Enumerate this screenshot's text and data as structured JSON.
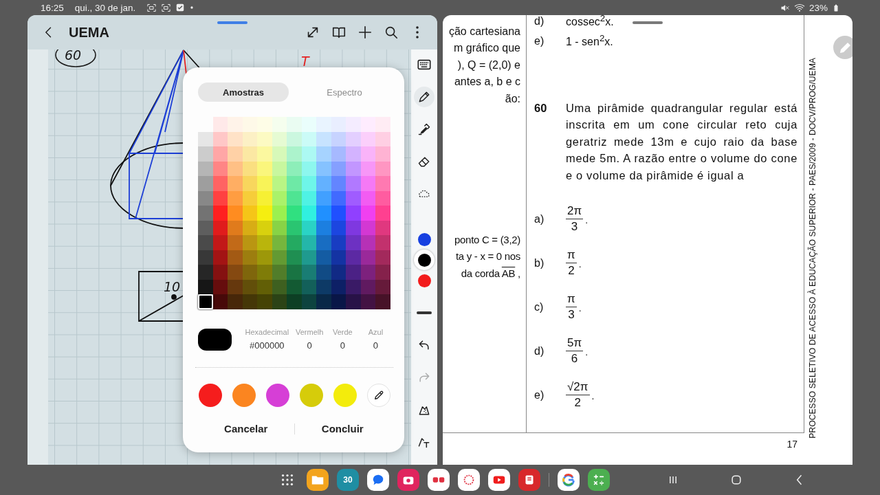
{
  "status_bar": {
    "time": "16:25",
    "date": "qui., 30 de jan.",
    "battery": "23%"
  },
  "note_app": {
    "title": "UEMA",
    "sketch_labels": [
      {
        "text": "60",
        "color": "#1a1a1a"
      },
      {
        "text": "T",
        "color": "#e52222"
      },
      {
        "text": "10",
        "color": "#1a1a1a"
      }
    ],
    "tools": [
      {
        "kind": "pen",
        "selected": true
      },
      {
        "kind": "highlighter",
        "selected": false
      },
      {
        "kind": "eraser",
        "selected": false
      },
      {
        "kind": "lasso",
        "selected": false
      }
    ],
    "pen_colors": [
      {
        "color": "#1740e0",
        "selected": false
      },
      {
        "color": "#000000",
        "selected": true
      },
      {
        "color": "#f21c1c",
        "selected": false
      }
    ],
    "history": [
      {
        "kind": "undo",
        "disabled": false
      },
      {
        "kind": "redo",
        "disabled": true
      }
    ],
    "shape_tools": [
      {
        "kind": "shape"
      },
      {
        "kind": "text-shape"
      }
    ]
  },
  "color_picker": {
    "tabs": [
      {
        "label": "Amostras",
        "selected": true
      },
      {
        "label": "Espectro",
        "selected": false
      }
    ],
    "grey_swatches": [
      {
        "color": "#E6E6E6",
        "selected": false
      },
      {
        "color": "#CCCCCC",
        "selected": false
      },
      {
        "color": "#B5B5B5",
        "selected": false
      },
      {
        "color": "#9E9E9E",
        "selected": false
      },
      {
        "color": "#888888",
        "selected": false
      },
      {
        "color": "#737373",
        "selected": false
      },
      {
        "color": "#5E5E5E",
        "selected": false
      },
      {
        "color": "#4A4A4A",
        "selected": false
      },
      {
        "color": "#383838",
        "selected": false
      },
      {
        "color": "#262626",
        "selected": false
      },
      {
        "color": "#161616",
        "selected": false
      },
      {
        "color": "#000000",
        "selected": true
      }
    ],
    "swatch_rows": [
      [
        {
          "color": "#FFE9E9",
          "selected": false
        },
        {
          "color": "#FFF3E9",
          "selected": false
        },
        {
          "color": "#FEF9E8",
          "selected": false
        },
        {
          "color": "#FEFDE7",
          "selected": false
        },
        {
          "color": "#F5FEEE",
          "selected": false
        },
        {
          "color": "#EAFCF2",
          "selected": false
        },
        {
          "color": "#EAFEFC",
          "selected": false
        },
        {
          "color": "#E9F4FF",
          "selected": false
        },
        {
          "color": "#E9EEFF",
          "selected": false
        },
        {
          "color": "#F4ECFF",
          "selected": false
        },
        {
          "color": "#FEECFE",
          "selected": false
        },
        {
          "color": "#FFECF4",
          "selected": false
        }
      ],
      [
        {
          "color": "#FFC7C7",
          "selected": false
        },
        {
          "color": "#FFE2C7",
          "selected": false
        },
        {
          "color": "#FCF0C5",
          "selected": false
        },
        {
          "color": "#FCFAC3",
          "selected": false
        },
        {
          "color": "#E6FBD3",
          "selected": false
        },
        {
          "color": "#CBF7DF",
          "selected": false
        },
        {
          "color": "#CBFBF7",
          "selected": false
        },
        {
          "color": "#C7E3FF",
          "selected": false
        },
        {
          "color": "#C7D3FF",
          "selected": false
        },
        {
          "color": "#E3CFFF",
          "selected": false
        },
        {
          "color": "#FBCFFB",
          "selected": false
        },
        {
          "color": "#FFCFE3",
          "selected": false
        }
      ],
      [
        {
          "color": "#FFA6A6",
          "selected": false
        },
        {
          "color": "#FFD1A6",
          "selected": false
        },
        {
          "color": "#FBE8A3",
          "selected": false
        },
        {
          "color": "#FBF89F",
          "selected": false
        },
        {
          "color": "#D7F9B9",
          "selected": false
        },
        {
          "color": "#ACF3CC",
          "selected": false
        },
        {
          "color": "#ACF9F3",
          "selected": false
        },
        {
          "color": "#A6D3FF",
          "selected": false
        },
        {
          "color": "#A6B9FF",
          "selected": false
        },
        {
          "color": "#D3B3FF",
          "selected": false
        },
        {
          "color": "#F9B3F9",
          "selected": false
        },
        {
          "color": "#FFB3D3",
          "selected": false
        }
      ],
      [
        {
          "color": "#FF8585",
          "selected": false
        },
        {
          "color": "#FFC085",
          "selected": false
        },
        {
          "color": "#FADF80",
          "selected": false
        },
        {
          "color": "#FAF67C",
          "selected": false
        },
        {
          "color": "#C8F79F",
          "selected": false
        },
        {
          "color": "#8DEEB9",
          "selected": false
        },
        {
          "color": "#8DF7EE",
          "selected": false
        },
        {
          "color": "#85C2FF",
          "selected": false
        },
        {
          "color": "#859FFF",
          "selected": false
        },
        {
          "color": "#C296FF",
          "selected": false
        },
        {
          "color": "#F796F7",
          "selected": false
        },
        {
          "color": "#FF96C2",
          "selected": false
        }
      ],
      [
        {
          "color": "#FF6363",
          "selected": false
        },
        {
          "color": "#FFAE63",
          "selected": false
        },
        {
          "color": "#F8D65D",
          "selected": false
        },
        {
          "color": "#F8F358",
          "selected": false
        },
        {
          "color": "#B9F585",
          "selected": false
        },
        {
          "color": "#6EE9A6",
          "selected": false
        },
        {
          "color": "#6EF5E9",
          "selected": false
        },
        {
          "color": "#63B1FF",
          "selected": false
        },
        {
          "color": "#6385FF",
          "selected": false
        },
        {
          "color": "#B179FF",
          "selected": false
        },
        {
          "color": "#F579F5",
          "selected": false
        },
        {
          "color": "#FF79B1",
          "selected": false
        }
      ],
      [
        {
          "color": "#FF4141",
          "selected": false
        },
        {
          "color": "#FF9D41",
          "selected": false
        },
        {
          "color": "#F6CD3A",
          "selected": false
        },
        {
          "color": "#F6F034",
          "selected": false
        },
        {
          "color": "#AAF26A",
          "selected": false
        },
        {
          "color": "#4FE493",
          "selected": false
        },
        {
          "color": "#4FF2E4",
          "selected": false
        },
        {
          "color": "#41A0FF",
          "selected": false
        },
        {
          "color": "#416AFF",
          "selected": false
        },
        {
          "color": "#A05CFF",
          "selected": false
        },
        {
          "color": "#F25CF2",
          "selected": false
        },
        {
          "color": "#FF5CA0",
          "selected": false
        }
      ],
      [
        {
          "color": "#FF2020",
          "selected": false
        },
        {
          "color": "#FF8C20",
          "selected": false
        },
        {
          "color": "#F5C518",
          "selected": false
        },
        {
          "color": "#F5EE10",
          "selected": false
        },
        {
          "color": "#9BF050",
          "selected": false
        },
        {
          "color": "#30E080",
          "selected": false
        },
        {
          "color": "#30F0E0",
          "selected": false
        },
        {
          "color": "#2090FF",
          "selected": false
        },
        {
          "color": "#2050FF",
          "selected": false
        },
        {
          "color": "#9040FF",
          "selected": false
        },
        {
          "color": "#F040F0",
          "selected": false
        },
        {
          "color": "#FF4090",
          "selected": false
        }
      ],
      [
        {
          "color": "#E01C1C",
          "selected": false
        },
        {
          "color": "#E07B1C",
          "selected": false
        },
        {
          "color": "#D8AD15",
          "selected": false
        },
        {
          "color": "#D8D10E",
          "selected": false
        },
        {
          "color": "#88D346",
          "selected": false
        },
        {
          "color": "#2AC571",
          "selected": false
        },
        {
          "color": "#2AD3C5",
          "selected": false
        },
        {
          "color": "#1C7FE0",
          "selected": false
        },
        {
          "color": "#1C46E0",
          "selected": false
        },
        {
          "color": "#7F38E0",
          "selected": false
        },
        {
          "color": "#D338D3",
          "selected": false
        },
        {
          "color": "#E0387F",
          "selected": false
        }
      ],
      [
        {
          "color": "#C21818",
          "selected": false
        },
        {
          "color": "#C26A18",
          "selected": false
        },
        {
          "color": "#BA9612",
          "selected": false
        },
        {
          "color": "#BAB50C",
          "selected": false
        },
        {
          "color": "#76B63D",
          "selected": false
        },
        {
          "color": "#24AA61",
          "selected": false
        },
        {
          "color": "#24B6AA",
          "selected": false
        },
        {
          "color": "#186DC2",
          "selected": false
        },
        {
          "color": "#183DC2",
          "selected": false
        },
        {
          "color": "#6D31C2",
          "selected": false
        },
        {
          "color": "#B631B6",
          "selected": false
        },
        {
          "color": "#C2316D",
          "selected": false
        }
      ],
      [
        {
          "color": "#A31414",
          "selected": false
        },
        {
          "color": "#A35A14",
          "selected": false
        },
        {
          "color": "#9D7E0F",
          "selected": false
        },
        {
          "color": "#9D980A",
          "selected": false
        },
        {
          "color": "#639A33",
          "selected": false
        },
        {
          "color": "#1F8F52",
          "selected": false
        },
        {
          "color": "#1F9A8F",
          "selected": false
        },
        {
          "color": "#145CA3",
          "selected": false
        },
        {
          "color": "#1433A3",
          "selected": false
        },
        {
          "color": "#5C29A3",
          "selected": false
        },
        {
          "color": "#9A299A",
          "selected": false
        },
        {
          "color": "#A3295C",
          "selected": false
        }
      ],
      [
        {
          "color": "#851111",
          "selected": false
        },
        {
          "color": "#854911",
          "selected": false
        },
        {
          "color": "#7F660C",
          "selected": false
        },
        {
          "color": "#7F7C08",
          "selected": false
        },
        {
          "color": "#517D2A",
          "selected": false
        },
        {
          "color": "#197443",
          "selected": false
        },
        {
          "color": "#197D74",
          "selected": false
        },
        {
          "color": "#114B85",
          "selected": false
        },
        {
          "color": "#112A85",
          "selected": false
        },
        {
          "color": "#4B2185",
          "selected": false
        },
        {
          "color": "#7D217D",
          "selected": false
        },
        {
          "color": "#85214B",
          "selected": false
        }
      ],
      [
        {
          "color": "#660D0D",
          "selected": false
        },
        {
          "color": "#66380D",
          "selected": false
        },
        {
          "color": "#624F0A",
          "selected": false
        },
        {
          "color": "#625F06",
          "selected": false
        },
        {
          "color": "#3E6020",
          "selected": false
        },
        {
          "color": "#135A33",
          "selected": false
        },
        {
          "color": "#13605A",
          "selected": false
        },
        {
          "color": "#0D3A66",
          "selected": false
        },
        {
          "color": "#0D2066",
          "selected": false
        },
        {
          "color": "#3A1A66",
          "selected": false
        },
        {
          "color": "#601A60",
          "selected": false
        },
        {
          "color": "#661A3A",
          "selected": false
        }
      ],
      [
        {
          "color": "#470909",
          "selected": false
        },
        {
          "color": "#472709",
          "selected": false
        },
        {
          "color": "#453707",
          "selected": false
        },
        {
          "color": "#454304",
          "selected": false
        },
        {
          "color": "#2B4316",
          "selected": false
        },
        {
          "color": "#0D3F24",
          "selected": false
        },
        {
          "color": "#0D433F",
          "selected": false
        },
        {
          "color": "#092847",
          "selected": false
        },
        {
          "color": "#091647",
          "selected": false
        },
        {
          "color": "#281247",
          "selected": false
        },
        {
          "color": "#431243",
          "selected": false
        },
        {
          "color": "#471228",
          "selected": false
        }
      ]
    ],
    "fields": [
      {
        "label": "Hexadecimal",
        "value": "#000000"
      },
      {
        "label": "Vermelh",
        "value": "0"
      },
      {
        "label": "Verde",
        "value": "0"
      },
      {
        "label": "Azul",
        "value": "0"
      }
    ],
    "recent_colors": [
      {
        "color": "#f51d1d"
      },
      {
        "color": "#fb8520"
      },
      {
        "color": "#d63fd6"
      },
      {
        "color": "#d6cc0a"
      },
      {
        "color": "#f3ec0c"
      }
    ],
    "buttons": [
      "Cancelar",
      "Concluir"
    ]
  },
  "document": {
    "left_lines_top": [
      "ção cartesiana",
      "m gráfico que",
      "), Q = (2,0) e",
      "antes a, b e c",
      "ão:"
    ],
    "left_lines_bottom": [
      {
        "text": "ponto C = (3,2)"
      },
      {
        "text": "ta y - x = 0 nos"
      },
      {
        "text": "da corda",
        "overline": "AB",
        "end": ","
      }
    ],
    "prev_options": [
      {
        "letter": "d)",
        "text": "cossec$^{2}$x."
      },
      {
        "letter": "e)",
        "text": "1 - sen$^{2}$x."
      }
    ],
    "question": {
      "number": "60",
      "text": "Uma pirâmide quadrangular regular está inscrita em um cone circular reto cuja geratriz mede 13m e cujo raio da base mede 5m. A razão entre o volume do cone e o volume da pirâmide é igual a"
    },
    "options": [
      {
        "letter": "a)",
        "numerator": "2π",
        "denominator": "3",
        "end": "."
      },
      {
        "letter": "b)",
        "numerator": "π",
        "denominator": "2",
        "end": "."
      },
      {
        "letter": "c)",
        "numerator": "π",
        "denominator": "3",
        "end": "."
      },
      {
        "letter": "d)",
        "numerator": "5π",
        "denominator": "6",
        "end": "."
      },
      {
        "letter": "e)",
        "numerator": "√2π",
        "denominator": "2",
        "end": "."
      }
    ],
    "page_number": "17",
    "side_text": "PROCESSO SELETIVO DE ACESSO À EDUCAÇÃO SUPERIOR - PAES/2009 - DOCV/PROG/UEMA"
  },
  "taskbar": {
    "calendar_day": "30"
  }
}
